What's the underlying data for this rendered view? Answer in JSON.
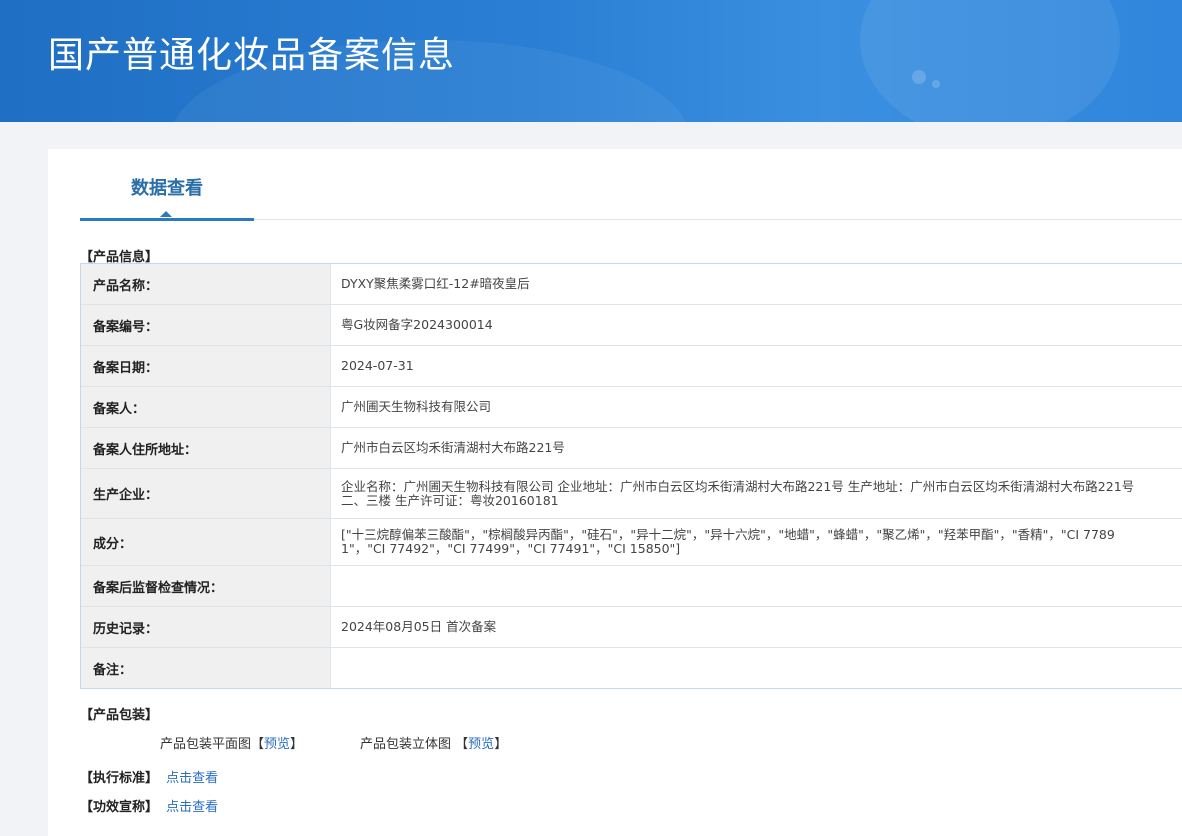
{
  "header": {
    "title": "国产普通化妆品备案信息"
  },
  "tab": {
    "label": "数据查看"
  },
  "sections": {
    "product_info": "【产品信息】",
    "packaging": "【产品包装】",
    "standard": "【执行标准】",
    "efficacy": "【功效宣称】"
  },
  "rows": [
    {
      "label": "产品名称：",
      "value": "DYXY聚焦柔雾口红-12#暗夜皇后"
    },
    {
      "label": "备案编号：",
      "value": "粤G妆网备字2024300014"
    },
    {
      "label": "备案日期：",
      "value": "2024-07-31"
    },
    {
      "label": "备案人：",
      "value": "广州圃天生物科技有限公司"
    },
    {
      "label": "备案人住所地址：",
      "value": "广州市白云区均禾街清湖村大布路221号"
    },
    {
      "label": "生产企业：",
      "value": "企业名称：广州圃天生物科技有限公司 企业地址：广州市白云区均禾街清湖村大布路221号 生产地址：广州市白云区均禾街清湖村大布路221号二、三楼 生产许可证：粤妆20160181"
    },
    {
      "label": "成分：",
      "value": "[\"十三烷醇偏苯三酸酯\"，\"棕榈酸异丙酯\"，\"硅石\"，\"异十二烷\"，\"异十六烷\"，\"地蜡\"，\"蜂蜡\"，\"聚乙烯\"，\"羟苯甲酯\"，\"香精\"，\"CI 77891\"，\"CI 77492\"，\"CI 77499\"，\"CI 77491\"，\"CI 15850\"]"
    },
    {
      "label": "备案后监督检查情况：",
      "value": ""
    },
    {
      "label": "历史记录：",
      "value": "2024年08月05日 首次备案"
    },
    {
      "label": "备注：",
      "value": ""
    }
  ],
  "packaging": {
    "flat_label": "产品包装平面图",
    "flat_bracket_open": "【",
    "flat_link": "预览",
    "flat_bracket_close": "】",
    "solid_label": "产品包装立体图",
    "solid_bracket_open": "【",
    "solid_link": "预览",
    "solid_bracket_close": "】"
  },
  "links": {
    "standard_link": "点击查看",
    "efficacy_link": "点击查看"
  },
  "colors": {
    "banner_blue": "#2a7fd4",
    "tab_blue": "#2a6ea8",
    "link_blue": "#2a6ec0"
  }
}
